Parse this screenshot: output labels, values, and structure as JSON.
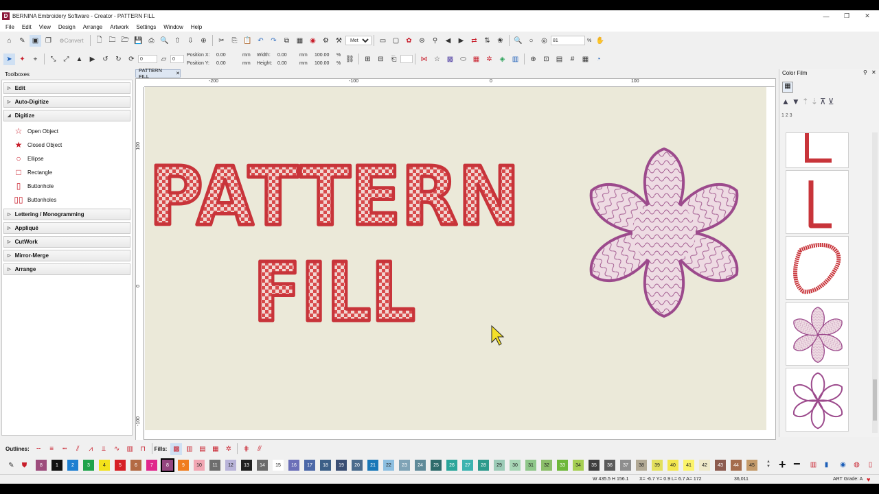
{
  "titlebar": {
    "title": "BERNINA Embroidery Software - Creator - PATTERN FILL",
    "icon": "D",
    "minimize": "—",
    "maximize": "❐",
    "close": "✕"
  },
  "menu": [
    "File",
    "Edit",
    "View",
    "Design",
    "Arrange",
    "Artwork",
    "Settings",
    "Window",
    "Help"
  ],
  "toolbar1": {
    "convert_label": "Convert",
    "units_value": "Metric",
    "zoom_value": "81",
    "zoom_unit": "%"
  },
  "toolbar2": {
    "angle_value": "0",
    "position_x_label": "Position X:",
    "position_x_value": "0.00",
    "position_y_label": "Position Y:",
    "position_y_value": "0.00",
    "width_label": "Width:",
    "width_value": "0.00",
    "height_label": "Height:",
    "height_value": "0.00",
    "unit_mm": "mm",
    "scale_w": "100.00",
    "scale_h": "100.00",
    "unit_pct": "%"
  },
  "toolboxes": {
    "title": "Toolboxes",
    "sections_top": [
      {
        "label": "Edit",
        "expanded": false
      },
      {
        "label": "Auto-Digitize",
        "expanded": false
      },
      {
        "label": "Digitize",
        "expanded": true
      }
    ],
    "digitize_tools": [
      {
        "label": "Open Object",
        "icon": "open-object-icon"
      },
      {
        "label": "Closed Object",
        "icon": "closed-object-icon"
      },
      {
        "label": "Ellipse",
        "icon": "ellipse-icon"
      },
      {
        "label": "Rectangle",
        "icon": "rectangle-icon"
      },
      {
        "label": "Buttonhole",
        "icon": "buttonhole-icon"
      },
      {
        "label": "Buttonholes",
        "icon": "buttonholes-icon"
      }
    ],
    "sections_bottom": [
      {
        "label": "Lettering / Monogramming"
      },
      {
        "label": "Appliqué"
      },
      {
        "label": "CutWork"
      },
      {
        "label": "Mirror-Merge"
      },
      {
        "label": "Arrange"
      }
    ]
  },
  "document": {
    "tab_label": "PATTERN FILL",
    "tab_close": "✕",
    "ruler_top": [
      "-200",
      "-100",
      "0",
      "100"
    ],
    "ruler_left": [
      "100",
      "0",
      "-100"
    ]
  },
  "design": {
    "line1": "PATTERN",
    "line2": "FILL",
    "fill_color": "#d23f42",
    "outline_color": "#c8343a",
    "flower_color": "#9c4a8c",
    "flower_fill": "#efd9e2"
  },
  "colorfilm": {
    "title": "Color Film",
    "sequence_label": "1 2 3"
  },
  "bottom": {
    "outlines_label": "Outlines:",
    "fills_label": "Fills:"
  },
  "palette": [
    {
      "n": "8",
      "c": "#9e4d7d"
    },
    {
      "n": "1",
      "c": "#111111"
    },
    {
      "n": "2",
      "c": "#1e7fd1"
    },
    {
      "n": "3",
      "c": "#1fa34a"
    },
    {
      "n": "4",
      "c": "#f3e21b"
    },
    {
      "n": "5",
      "c": "#d61f26"
    },
    {
      "n": "6",
      "c": "#b36a44"
    },
    {
      "n": "7",
      "c": "#e0268c"
    },
    {
      "n": "8",
      "c": "#94467f"
    },
    {
      "n": "9",
      "c": "#f07d1f"
    },
    {
      "n": "10",
      "c": "#f1a6b3"
    },
    {
      "n": "11",
      "c": "#6d6d6d"
    },
    {
      "n": "12",
      "c": "#b9b4d9"
    },
    {
      "n": "13",
      "c": "#1f1f1f"
    },
    {
      "n": "14",
      "c": "#6b6b6b"
    },
    {
      "n": "15",
      "c": "#ffffff"
    },
    {
      "n": "16",
      "c": "#6b6fb8"
    },
    {
      "n": "17",
      "c": "#4c68a8"
    },
    {
      "n": "18",
      "c": "#3c5f87"
    },
    {
      "n": "19",
      "c": "#3b4f74"
    },
    {
      "n": "20",
      "c": "#4a6b8c"
    },
    {
      "n": "21",
      "c": "#1a78b8"
    },
    {
      "n": "22",
      "c": "#8dbfe0"
    },
    {
      "n": "23",
      "c": "#7fa3b6"
    },
    {
      "n": "24",
      "c": "#5f8a99"
    },
    {
      "n": "25",
      "c": "#2f6b6b"
    },
    {
      "n": "26",
      "c": "#2aa59a"
    },
    {
      "n": "27",
      "c": "#3cb3b0"
    },
    {
      "n": "28",
      "c": "#2c9a8c"
    },
    {
      "n": "29",
      "c": "#9ccbb7"
    },
    {
      "n": "30",
      "c": "#a8d7b6"
    },
    {
      "n": "31",
      "c": "#8fc78a"
    },
    {
      "n": "32",
      "c": "#8cbf6a"
    },
    {
      "n": "33",
      "c": "#6fb83b"
    },
    {
      "n": "34",
      "c": "#a6cf52"
    },
    {
      "n": "35",
      "c": "#3d3d3d"
    },
    {
      "n": "36",
      "c": "#5b5b5b"
    },
    {
      "n": "37",
      "c": "#8e8e8e"
    },
    {
      "n": "38",
      "c": "#b2a995"
    },
    {
      "n": "39",
      "c": "#e3e05e"
    },
    {
      "n": "40",
      "c": "#f2e64e"
    },
    {
      "n": "41",
      "c": "#fbf36a"
    },
    {
      "n": "42",
      "c": "#efe9c8"
    },
    {
      "n": "43",
      "c": "#8c5b50"
    },
    {
      "n": "44",
      "c": "#a56d4d"
    },
    {
      "n": "45",
      "c": "#c49b6b"
    }
  ],
  "status": {
    "dimensions": "W 435.5 H 156.1",
    "coords": "X= -6.7 Y= 0.9 L= 6.7 A= 172",
    "stitches": "36,011",
    "grade": "ART Grade: A"
  }
}
